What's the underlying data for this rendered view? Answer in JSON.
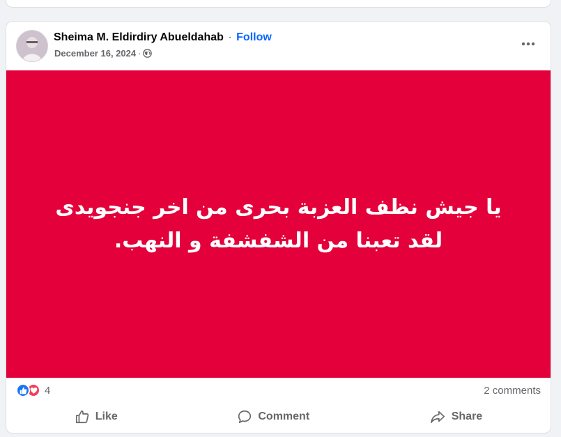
{
  "post": {
    "author": "Sheima M. Eldirdiry Abueldahab",
    "separator": "·",
    "follow_label": "Follow",
    "date": "December 16, 2024",
    "date_separator": "·",
    "privacy_icon": "globe-icon",
    "more_icon": "more-options-icon",
    "background_color": "#e4003a",
    "text": "يا جيش نظف العزبة بحرى من اخر جنجويدى لقد تعبنا من الشفشفة و النهب.",
    "reaction_icons": [
      "like-reaction-icon",
      "love-reaction-icon"
    ],
    "reactions_count": "4",
    "comments_count": "2 comments"
  },
  "actions": {
    "like_label": "Like",
    "comment_label": "Comment",
    "share_label": "Share"
  },
  "colors": {
    "accent": "#0866ff",
    "like_blue": "#1877f2",
    "love_red": "#f33e58",
    "secondary_text": "#65676b"
  }
}
